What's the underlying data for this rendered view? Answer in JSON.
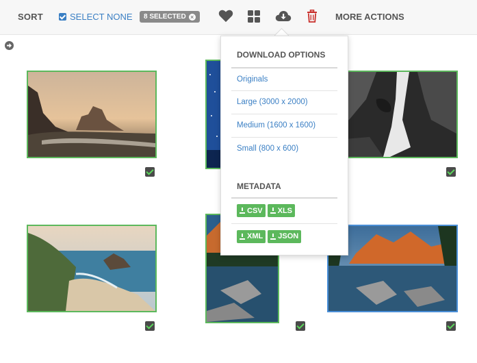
{
  "toolbar": {
    "sort_label": "SORT",
    "select_none_label": "SELECT NONE",
    "selected_badge": "8 SELECTED",
    "more_actions_label": "MORE ACTIONS",
    "icons": [
      "heart-icon",
      "grid-icon",
      "cloud-download-icon",
      "trash-icon"
    ],
    "accent_color": "#3a7fc4",
    "danger_color": "#c9302c"
  },
  "download_menu": {
    "heading": "DOWNLOAD OPTIONS",
    "options": [
      "Originals",
      "Large (3000 x 2000)",
      "Medium (1600 x 1600)",
      "Small (800 x 600)"
    ],
    "metadata_heading": "METADATA",
    "metadata_formats": [
      "CSV",
      "XLS",
      "XML",
      "JSON"
    ]
  },
  "gallery": {
    "selected_color": "#5cb85c",
    "photos": [
      {
        "subject": "sea-stack-sunset",
        "selected": true
      },
      {
        "subject": "starry-night",
        "selected": true
      },
      {
        "subject": "waterfall-bw",
        "selected": true
      },
      {
        "subject": "coastal-cove",
        "selected": true
      },
      {
        "subject": "mountain-lake-portrait",
        "selected": true
      },
      {
        "subject": "mountain-lake-landscape",
        "selected": true
      }
    ]
  }
}
